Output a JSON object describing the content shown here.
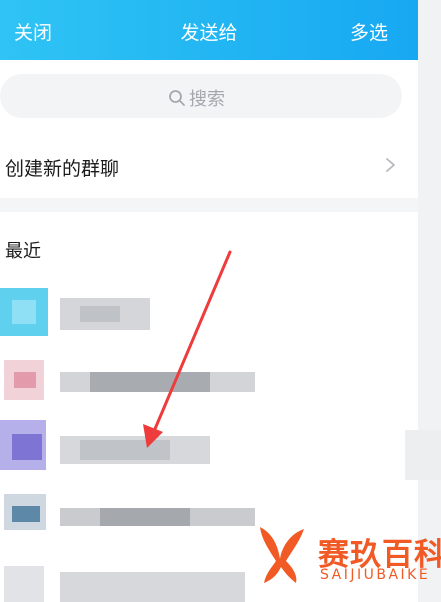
{
  "header": {
    "close_label": "关闭",
    "title": "发送给",
    "multi_select_label": "多选",
    "background_color": "#1fb4f4"
  },
  "search": {
    "placeholder": "搜索",
    "icon": "search-icon"
  },
  "create_group": {
    "label": "创建新的群聊",
    "icon": "chevron-right-icon"
  },
  "recent": {
    "section_title": "最近",
    "contacts": [
      {
        "avatar_color": "#5fd0ee",
        "name_obscured": true
      },
      {
        "avatar_color": "#e8a6b4",
        "name_obscured": true
      },
      {
        "avatar_color": "#8c84d8",
        "name_obscured": true
      },
      {
        "avatar_color": "#5d88a8",
        "name_obscured": true
      },
      {
        "avatar_color": "#d6d8db",
        "name_obscured": true
      }
    ]
  },
  "annotation": {
    "type": "arrow",
    "color": "#ee3b3b"
  },
  "watermark": {
    "brand_cn": "赛玖百科",
    "brand_en": "SAIJIUBAIKE",
    "color": "#f15a24"
  }
}
